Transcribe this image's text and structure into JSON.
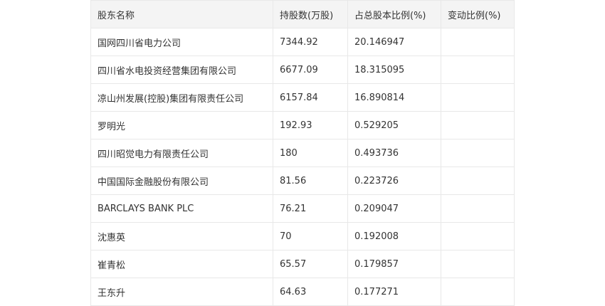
{
  "table": {
    "headers": [
      "股东名称",
      "持股数(万股)",
      "占总股本比例(%)",
      "变动比例(%)"
    ],
    "rows": [
      [
        "国网四川省电力公司",
        "7344.92",
        "20.146947",
        ""
      ],
      [
        "四川省水电投资经营集团有限公司",
        "6677.09",
        "18.315095",
        ""
      ],
      [
        "凉山州发展(控股)集团有限责任公司",
        "6157.84",
        "16.890814",
        ""
      ],
      [
        "罗明光",
        "192.93",
        "0.529205",
        ""
      ],
      [
        "四川昭觉电力有限责任公司",
        "180",
        "0.493736",
        ""
      ],
      [
        "中国国际金融股份有限公司",
        "81.56",
        "0.223726",
        ""
      ],
      [
        "BARCLAYS BANK PLC",
        "76.21",
        "0.209047",
        ""
      ],
      [
        "沈惠英",
        "70",
        "0.192008",
        ""
      ],
      [
        "崔青松",
        "65.57",
        "0.179857",
        ""
      ],
      [
        "王东升",
        "64.63",
        "0.177271",
        ""
      ]
    ]
  }
}
